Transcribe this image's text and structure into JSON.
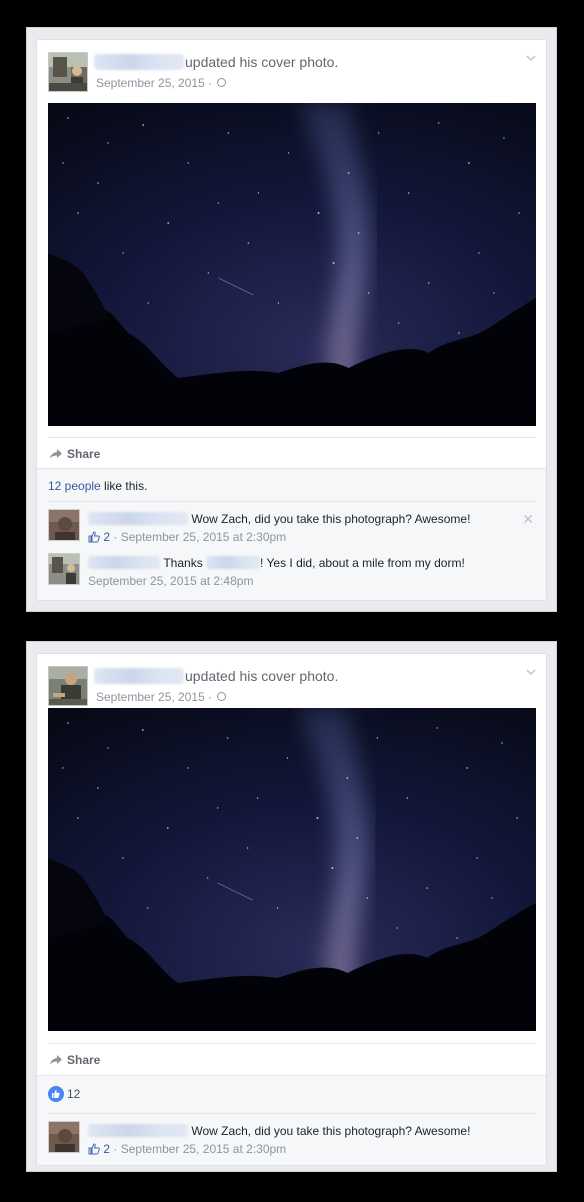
{
  "posts": [
    {
      "headline": "updated his cover photo.",
      "date": "September 25, 2015",
      "date_sep": "·",
      "share_label": "Share",
      "likes_link": "12 people",
      "likes_rest": " like this.",
      "comments": [
        {
          "text": "Wow Zach, did you take this photograph? Awesome!",
          "like_count": "2",
          "time": "September 25, 2015 at 2:30pm"
        },
        {
          "text_before": "Thanks",
          "text_after": "! Yes I did, about a mile from my dorm!",
          "time": "September 25, 2015 at 2:48pm"
        }
      ]
    },
    {
      "headline": "updated his cover photo.",
      "date": "September 25, 2015",
      "date_sep": "·",
      "share_label": "Share",
      "like_count": "12",
      "comments": [
        {
          "text": "Wow Zach, did you take this photograph? Awesome!",
          "like_count": "2",
          "time": "September 25, 2015 at 2:30pm"
        }
      ]
    }
  ],
  "colors": {
    "link": "#365899",
    "meta": "#8d949e",
    "like_blue": "#4a84f0",
    "frame_bg": "#e9ebee"
  },
  "icons": [
    "globe-icon",
    "chevron-down-icon",
    "share-arrow-icon",
    "thumbs-up-icon",
    "close-icon"
  ]
}
